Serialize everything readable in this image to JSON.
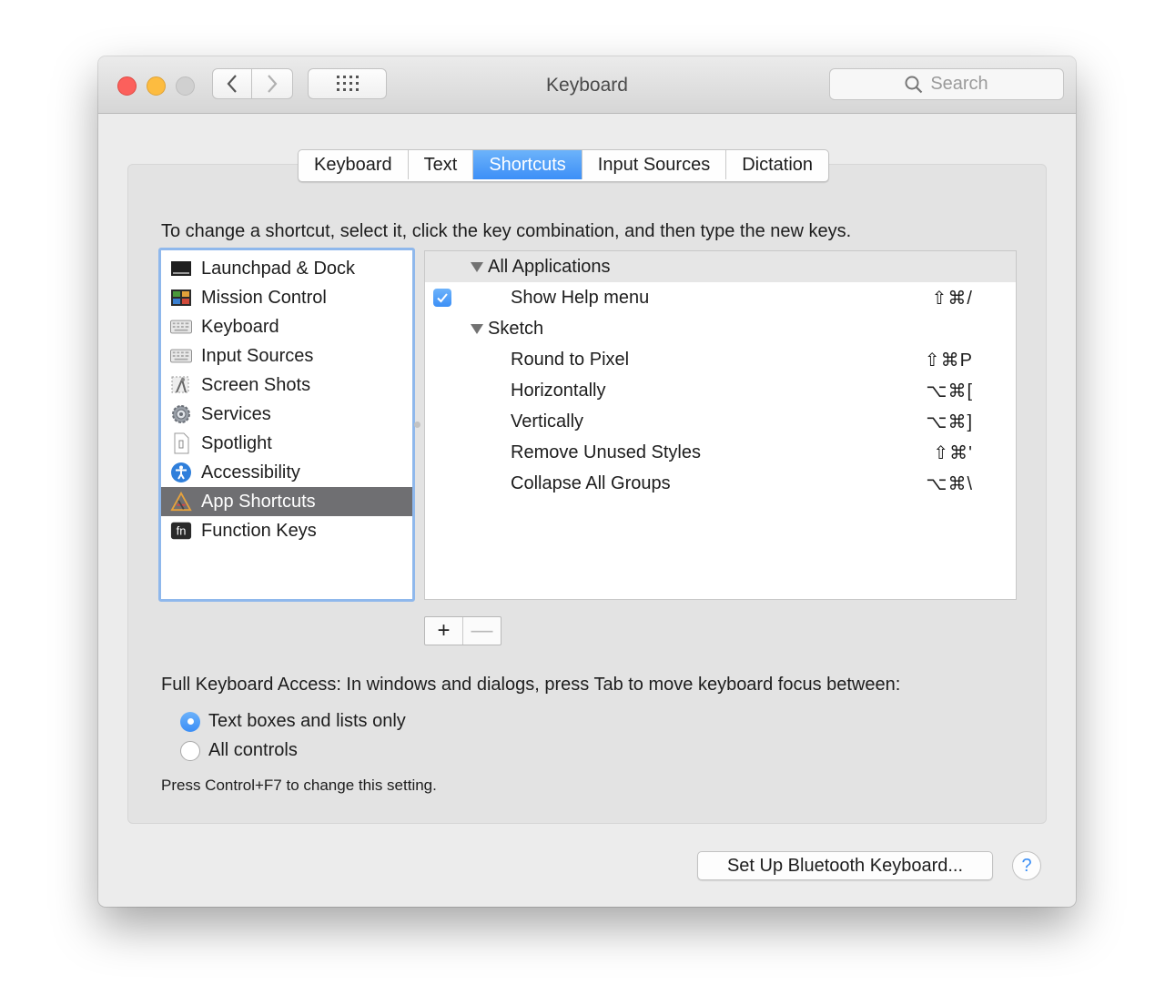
{
  "window": {
    "title": "Keyboard"
  },
  "toolbar": {
    "back_icon": "chevron-left-icon",
    "forward_icon": "chevron-right-icon",
    "grid_icon": "grid-icon",
    "search_placeholder": "Search"
  },
  "tabs": [
    {
      "label": "Keyboard",
      "active": false
    },
    {
      "label": "Text",
      "active": false
    },
    {
      "label": "Shortcuts",
      "active": true
    },
    {
      "label": "Input Sources",
      "active": false
    },
    {
      "label": "Dictation",
      "active": false
    }
  ],
  "instructions": "To change a shortcut, select it, click the key combination, and then type the new keys.",
  "categories": [
    {
      "label": "Launchpad & Dock",
      "icon": "launchpad-dock-icon",
      "selected": false
    },
    {
      "label": "Mission Control",
      "icon": "mission-control-icon",
      "selected": false
    },
    {
      "label": "Keyboard",
      "icon": "keyboard-icon",
      "selected": false
    },
    {
      "label": "Input Sources",
      "icon": "input-sources-icon",
      "selected": false
    },
    {
      "label": "Screen Shots",
      "icon": "screen-shots-icon",
      "selected": false
    },
    {
      "label": "Services",
      "icon": "gear-icon",
      "selected": false
    },
    {
      "label": "Spotlight",
      "icon": "spotlight-icon",
      "selected": false
    },
    {
      "label": "Accessibility",
      "icon": "accessibility-icon",
      "selected": false
    },
    {
      "label": "App Shortcuts",
      "icon": "app-shortcuts-icon",
      "selected": true
    },
    {
      "label": "Function Keys",
      "icon": "fn-key-icon",
      "selected": false
    }
  ],
  "shortcut_groups": [
    {
      "label": "All Applications",
      "items": [
        {
          "label": "Show Help menu",
          "keys": "⇧⌘/",
          "checked": true
        }
      ]
    },
    {
      "label": "Sketch",
      "items": [
        {
          "label": "Round to Pixel",
          "keys": "⇧⌘P"
        },
        {
          "label": "Horizontally",
          "keys": "⌥⌘["
        },
        {
          "label": "Vertically",
          "keys": "⌥⌘]"
        },
        {
          "label": "Remove Unused Styles",
          "keys": "⇧⌘'"
        },
        {
          "label": "Collapse All Groups",
          "keys": "⌥⌘\\"
        }
      ]
    }
  ],
  "list_controls": {
    "add": "+",
    "remove": "—"
  },
  "full_keyboard_access": {
    "label": "Full Keyboard Access: In windows and dialogs, press Tab to move keyboard focus between:",
    "options": [
      {
        "label": "Text boxes and lists only",
        "selected": true
      },
      {
        "label": "All controls",
        "selected": false
      }
    ],
    "note": "Press Control+F7 to change this setting."
  },
  "bluetooth_button": "Set Up Bluetooth Keyboard...",
  "help_button": "?"
}
